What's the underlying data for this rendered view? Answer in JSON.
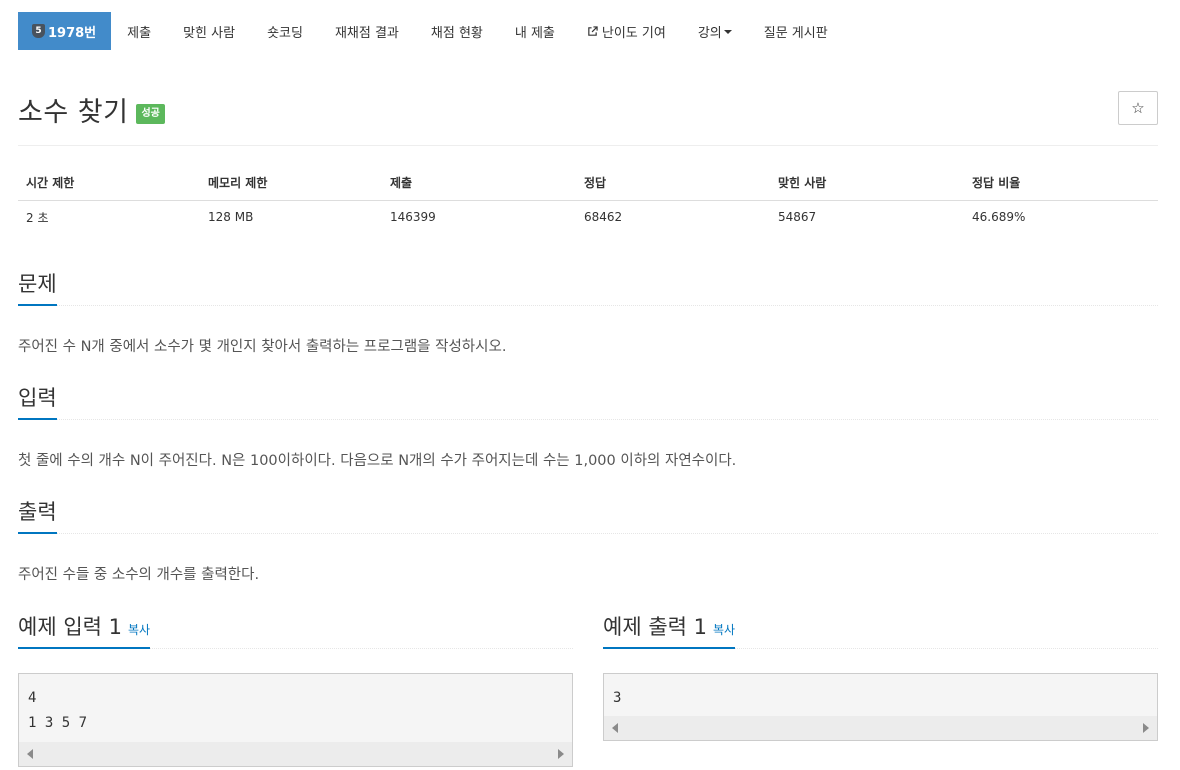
{
  "nav": {
    "problem": {
      "tier": "5",
      "number": "1978번"
    },
    "items": [
      {
        "label": "제출"
      },
      {
        "label": "맞힌 사람"
      },
      {
        "label": "숏코딩"
      },
      {
        "label": "재채점 결과"
      },
      {
        "label": "채점 현황"
      },
      {
        "label": "내 제출"
      },
      {
        "label": "난이도 기여",
        "icon": "external-link-icon"
      },
      {
        "label": "강의",
        "icon": "caret-down-icon"
      },
      {
        "label": "질문 게시판"
      }
    ]
  },
  "problem": {
    "title": "소수 찾기",
    "status_badge": "성공",
    "star": "☆"
  },
  "info": {
    "headers": [
      "시간 제한",
      "메모리 제한",
      "제출",
      "정답",
      "맞힌 사람",
      "정답 비율"
    ],
    "values": [
      "2 초",
      "128 MB",
      "146399",
      "68462",
      "54867",
      "46.689%"
    ]
  },
  "sections": {
    "description": {
      "title": "문제",
      "text": "주어진 수 N개 중에서 소수가 몇 개인지 찾아서 출력하는 프로그램을 작성하시오."
    },
    "input": {
      "title": "입력",
      "text": "첫 줄에 수의 개수 N이 주어진다. N은 100이하이다. 다음으로 N개의 수가 주어지는데 수는 1,000 이하의 자연수이다."
    },
    "output": {
      "title": "출력",
      "text": "주어진 수들 중 소수의 개수를 출력한다."
    }
  },
  "samples": {
    "input": {
      "title": "예제 입력 1",
      "copy": "복사",
      "content": "4\n1 3 5 7"
    },
    "output": {
      "title": "예제 출력 1",
      "copy": "복사",
      "content": "3"
    }
  },
  "colors": {
    "accent": "#0076c0",
    "nav_active": "#428bca",
    "success": "#5cb85c"
  }
}
